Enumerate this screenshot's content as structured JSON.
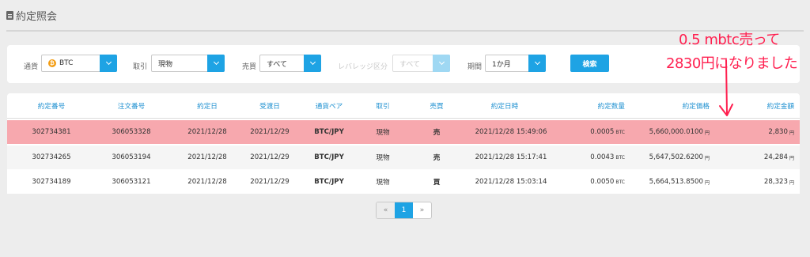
{
  "page": {
    "title": "約定照会"
  },
  "filters": {
    "currency": {
      "label": "通貨",
      "value": "BTC",
      "coin_symbol": "₿"
    },
    "trade": {
      "label": "取引",
      "value": "現物"
    },
    "buysell": {
      "label": "売買",
      "value": "すべて"
    },
    "leverage": {
      "label": "レバレッジ区分",
      "value": "すべて"
    },
    "period": {
      "label": "期間",
      "value": "1か月"
    },
    "search_label": "検索"
  },
  "table": {
    "headers": [
      "約定番号",
      "注文番号",
      "約定日",
      "受渡日",
      "通貨ペア",
      "取引",
      "売買",
      "約定日時",
      "約定数量",
      "約定価格",
      "約定金額"
    ],
    "rows": [
      {
        "exec_no": "302734381",
        "order_no": "306053328",
        "exec_date": "2021/12/28",
        "settle_date": "2021/12/29",
        "pair": "BTC/JPY",
        "trade": "現物",
        "side": "売",
        "datetime": "2021/12/28 15:49:06",
        "qty": "0.0005",
        "qty_unit": "BTC",
        "price": "5,660,000.0100",
        "price_unit": "円",
        "amount": "2,830",
        "amount_unit": "円"
      },
      {
        "exec_no": "302734265",
        "order_no": "306053194",
        "exec_date": "2021/12/28",
        "settle_date": "2021/12/29",
        "pair": "BTC/JPY",
        "trade": "現物",
        "side": "売",
        "datetime": "2021/12/28 15:17:41",
        "qty": "0.0043",
        "qty_unit": "BTC",
        "price": "5,647,502.6200",
        "price_unit": "円",
        "amount": "24,284",
        "amount_unit": "円"
      },
      {
        "exec_no": "302734189",
        "order_no": "306053121",
        "exec_date": "2021/12/28",
        "settle_date": "2021/12/29",
        "pair": "BTC/JPY",
        "trade": "現物",
        "side": "買",
        "datetime": "2021/12/28 15:03:14",
        "qty": "0.0050",
        "qty_unit": "BTC",
        "price": "5,664,513.8500",
        "price_unit": "円",
        "amount": "28,323",
        "amount_unit": "円"
      }
    ]
  },
  "pagination": {
    "prev": "«",
    "current": "1",
    "next": "»"
  },
  "annotation": {
    "line1": "0.5 mbtc売って",
    "line2": "2830円になりました",
    "color": "#ff1f4f"
  }
}
